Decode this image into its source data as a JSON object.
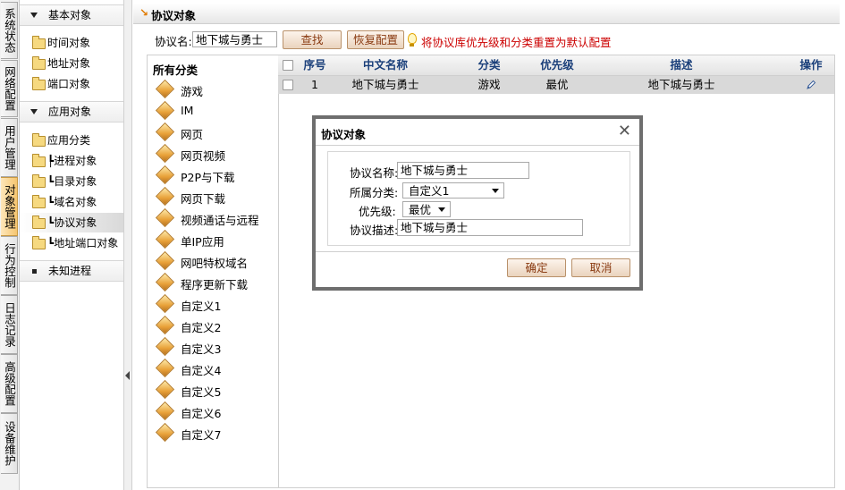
{
  "vertical_tabs": [
    {
      "label": "系统状态",
      "active": false
    },
    {
      "label": "网络配置",
      "active": false
    },
    {
      "label": "用户管理",
      "active": false
    },
    {
      "label": "对象管理",
      "active": true
    },
    {
      "label": "行为控制",
      "active": false
    },
    {
      "label": "日志记录",
      "active": false
    },
    {
      "label": "高级配置",
      "active": false
    },
    {
      "label": "设备维护",
      "active": false
    }
  ],
  "tree": {
    "basic_group": "基本对象",
    "basic_items": [
      "时间对象",
      "地址对象",
      "端口对象"
    ],
    "app_group": "应用对象",
    "app_items": [
      "应用分类",
      "┡进程对象",
      "┗目录对象",
      "┗域名对象",
      "┗协议对象",
      "┗地址端口对象"
    ],
    "unknown": "未知进程",
    "selected": "┗协议对象"
  },
  "panel": {
    "title": "协议对象",
    "search_label": "协议名:",
    "search_value": "地下城与勇士",
    "find_button": "查找",
    "restore_button": "恢复配置",
    "hint": "将协议库优先级和分类重置为默认配置"
  },
  "categories": {
    "header": "所有分类",
    "items": [
      "游戏",
      "IM",
      "网页",
      "网页视频",
      "P2P与下载",
      "网页下载",
      "视频通话与远程",
      "单IP应用",
      "网吧特权域名",
      "程序更新下载",
      "自定义1",
      "自定义2",
      "自定义3",
      "自定义4",
      "自定义5",
      "自定义6",
      "自定义7"
    ]
  },
  "table": {
    "columns": [
      "序号",
      "中文名称",
      "分类",
      "优先级",
      "描述",
      "操作"
    ],
    "rows": [
      {
        "index": "1",
        "name": "地下城与勇士",
        "category": "游戏",
        "priority": "最优",
        "description": "地下城与勇士"
      }
    ]
  },
  "dialog": {
    "title": "协议对象",
    "name_label": "协议名称:",
    "name_value": "地下城与勇士",
    "category_label": "所属分类:",
    "category_value": "自定义1",
    "priority_label": "优先级:",
    "priority_value": "最优",
    "desc_label": "协议描述:",
    "desc_value": "地下城与勇士",
    "ok_button": "确定",
    "cancel_button": "取消"
  },
  "colors": {
    "accent_orange": "#e07b00",
    "hint_red": "#cc0000",
    "header_blue": "#1a3f7a",
    "active_tab": "#f6c56f"
  }
}
